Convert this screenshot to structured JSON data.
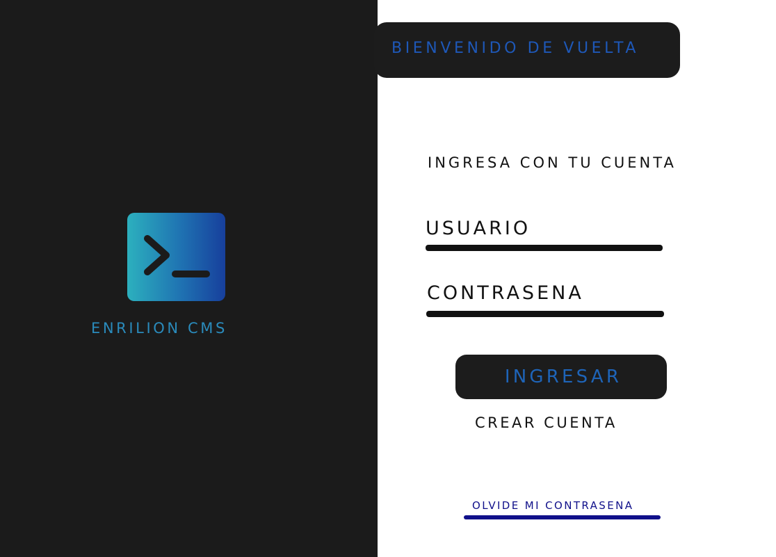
{
  "brand": {
    "name": "ENRILION CMS",
    "logo_icon": "terminal-prompt-icon"
  },
  "header": {
    "welcome_text": "BIENVENIDO DE VUELTA"
  },
  "login": {
    "heading": "INGRESA CON TU CUENTA",
    "username_label": "USUARIO",
    "username_value": "",
    "password_label": "CONTRASENA",
    "password_value": "",
    "submit_label": "INGRESAR",
    "create_account_label": "CREAR CUENTA",
    "forgot_password_label": "OLVIDE MI CONTRASENA"
  },
  "colors": {
    "left_panel_bg": "#1b1b1b",
    "accent_blue": "#1e58b8",
    "brand_text": "#2a8bbc",
    "link_blue": "#10108a",
    "logo_gradient_start": "#2cb0be",
    "logo_gradient_end": "#173f9c"
  }
}
